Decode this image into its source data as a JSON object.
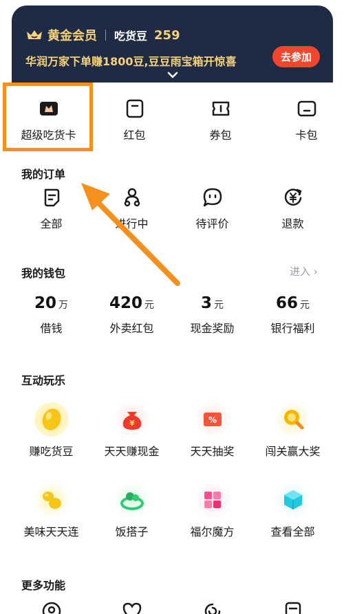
{
  "member": {
    "title": "黄金会员",
    "beans_label": "吃货豆",
    "beans_count": "259",
    "promo_text": "华润万家下单赚1800豆,豆豆雨宝箱开惊喜",
    "join_label": "去参加"
  },
  "cards": [
    {
      "label": "超级吃货卡",
      "icon": "super-card-icon"
    },
    {
      "label": "红包",
      "icon": "red-packet-icon"
    },
    {
      "label": "券包",
      "icon": "coupon-icon"
    },
    {
      "label": "卡包",
      "icon": "card-wallet-icon"
    }
  ],
  "orders": {
    "title": "我的订单",
    "items": [
      {
        "label": "全部",
        "icon": "all-orders-icon"
      },
      {
        "label": "进行中",
        "icon": "rider-icon"
      },
      {
        "label": "待评价",
        "icon": "review-icon"
      },
      {
        "label": "退款",
        "icon": "refund-icon"
      }
    ]
  },
  "wallet": {
    "title": "我的钱包",
    "enter_label": "进入 ›",
    "items": [
      {
        "value": "20",
        "unit": "万",
        "label": "借钱"
      },
      {
        "value": "420",
        "unit": "元",
        "label": "外卖红包"
      },
      {
        "value": "3",
        "unit": "元",
        "label": "现金奖励"
      },
      {
        "value": "66",
        "unit": "元",
        "label": "银行福利"
      }
    ]
  },
  "fun": {
    "title": "互动玩乐",
    "row1": [
      {
        "label": "赚吃货豆",
        "icon": "bean-icon"
      },
      {
        "label": "天天赚现金",
        "icon": "money-bag-icon"
      },
      {
        "label": "天天抽奖",
        "icon": "lottery-icon"
      },
      {
        "label": "闯关赢大奖",
        "icon": "magnifier-prize-icon"
      }
    ],
    "row2": [
      {
        "label": "美味天天连",
        "icon": "match-game-icon"
      },
      {
        "label": "饭搭子",
        "icon": "partner-icon"
      },
      {
        "label": "福尔魔方",
        "icon": "cube-icon"
      },
      {
        "label": "查看全部",
        "icon": "view-all-icon"
      }
    ]
  },
  "more": {
    "title": "更多功能"
  },
  "colors": {
    "banner_bg": "#1f2a45",
    "gold": "#f6d27a",
    "join_button": "#f1462e",
    "highlight": "#f4901e"
  }
}
